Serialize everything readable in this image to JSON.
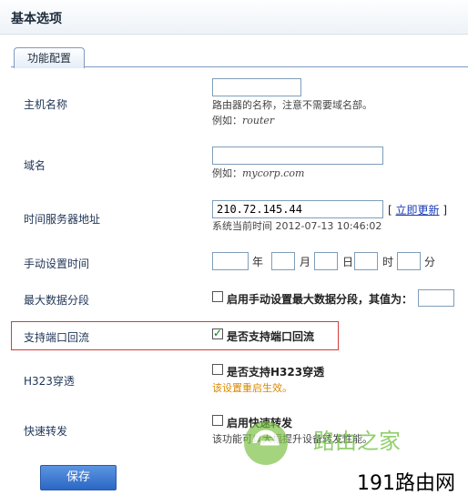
{
  "header": {
    "title": "基本选项"
  },
  "tabs": [
    {
      "label": "功能配置"
    }
  ],
  "fields": {
    "hostname": {
      "label": "主机名称",
      "value": "",
      "hint": "路由器的名称，注意不需要域名部。",
      "example_prefix": "例如：",
      "example_value": "router"
    },
    "domain": {
      "label": "域名",
      "value": "",
      "example_prefix": "例如：",
      "example_value": "mycorp.com"
    },
    "ntp": {
      "label": "时间服务器地址",
      "value": "210.72.145.44",
      "bracket_open": "[",
      "update_link": "立即更新",
      "bracket_close": "]",
      "system_time": "系统当前时间 2012-07-13 10:46:02"
    },
    "manual_time": {
      "label": "手动设置时间",
      "units": [
        "年",
        "月",
        "日",
        "时",
        "分"
      ]
    },
    "mss": {
      "label": "最大数据分段",
      "checkbox_label": "启用手动设置最大数据分段，其值为：",
      "checked": false,
      "value": ""
    },
    "loopback": {
      "label": "支持端口回流",
      "checkbox_label": "是否支持端口回流",
      "checked": true
    },
    "h323": {
      "label": "H323穿透",
      "checkbox_label": "是否支持H323穿透",
      "checked": false,
      "note": "该设置重启生效。"
    },
    "fast_forward": {
      "label": "快速转发",
      "checkbox_label": "启用快速转发",
      "checked": false,
      "note": "该功能可以大幅提升设备转发性能。"
    }
  },
  "actions": {
    "save_label": "保存"
  },
  "watermarks": {
    "logo_text": "路由之家",
    "site_text": "191路由网"
  },
  "colors": {
    "highlight_border": "#d9393a",
    "save_button": "#2b67c4",
    "note_text": "#d98a00",
    "link": "#1a3bb5"
  }
}
